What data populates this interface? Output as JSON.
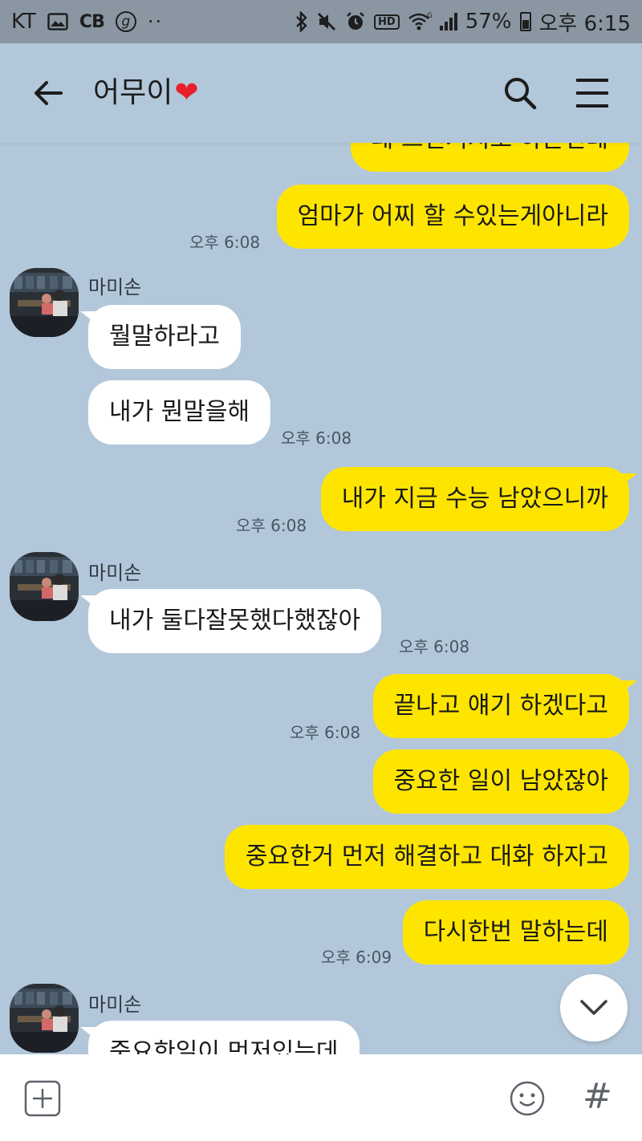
{
  "status_bar": {
    "carrier": "KT",
    "cb_label": "CB",
    "g_label": "g",
    "dots": "··",
    "hd_label": "HD",
    "wifi_label": "G",
    "battery": "57%",
    "time": "오후 6:15"
  },
  "header": {
    "title": "어무이",
    "title_emoji": "❤",
    "back_icon": "arrow-left-icon",
    "search_icon": "search-icon",
    "menu_icon": "hamburger-menu-icon"
  },
  "messages": [
    {
      "side": "me",
      "text": "왜 그런거지도 하는건데"
    },
    {
      "side": "me",
      "text": "엄마가 어찌 할 수있는게아니라",
      "time": "오후 6:08"
    },
    {
      "side": "them",
      "sender": "마미손",
      "text": "뭘말하라고"
    },
    {
      "side": "them",
      "text": "내가 뭔말을해",
      "time": "오후 6:08"
    },
    {
      "side": "me",
      "text": "내가 지금 수능 남았으니까",
      "time": "오후 6:08"
    },
    {
      "side": "them",
      "sender": "마미손",
      "text": "내가 둘다잘못했다했잖아",
      "time": "오후 6:08"
    },
    {
      "side": "me",
      "text": "끝나고 얘기 하겠다고",
      "time": "오후 6:08"
    },
    {
      "side": "me",
      "text": "중요한 일이 남았잖아"
    },
    {
      "side": "me",
      "text": "중요한거 먼저 해결하고 대화 하자고"
    },
    {
      "side": "me",
      "text": "다시한번 말하는데",
      "time": "오후 6:09"
    },
    {
      "side": "them",
      "sender": "마미손",
      "text": "중요한일이 먼저있는데"
    }
  ],
  "input_bar": {
    "plus_icon": "plus-square-icon",
    "emoji_icon": "emoji-smile-icon",
    "hash_label": "#"
  },
  "colors": {
    "background": "#b2c7da",
    "my_bubble": "#fee500",
    "their_bubble": "#ffffff",
    "status_bar": "#8a97a3"
  }
}
